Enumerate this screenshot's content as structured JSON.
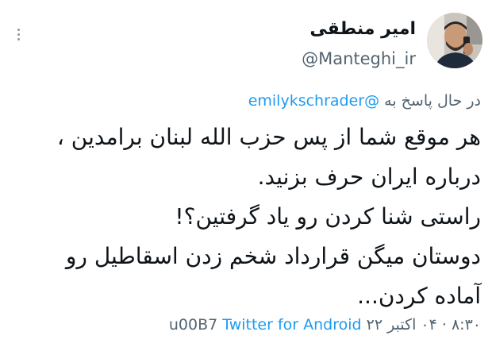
{
  "author": {
    "display_name": "امیر منطقی",
    "username": "@Manteghi_ir"
  },
  "reply": {
    "prefix": "در حال پاسخ به",
    "mention": "@emilykschrader"
  },
  "tweet": {
    "lines": [
      "هر موقع شما از پس حزب الله لبنان برامدین ،",
      "درباره ایران حرف بزنید.",
      "راستی شنا کردن رو یاد گرفتین؟!",
      "دوستان میگن قرارداد شخم زدن اسقاطیل رو",
      "آماده کردن..."
    ]
  },
  "footer": {
    "time": "۸:۳۰ ",
    "sep1": "· ",
    "date": "۰۴ اکتبر ۲۲",
    "sep2": " ",
    "garbled": "u00B7",
    "source": "Twitter for Android"
  },
  "icons": {
    "more": "more-vertical-icon"
  }
}
